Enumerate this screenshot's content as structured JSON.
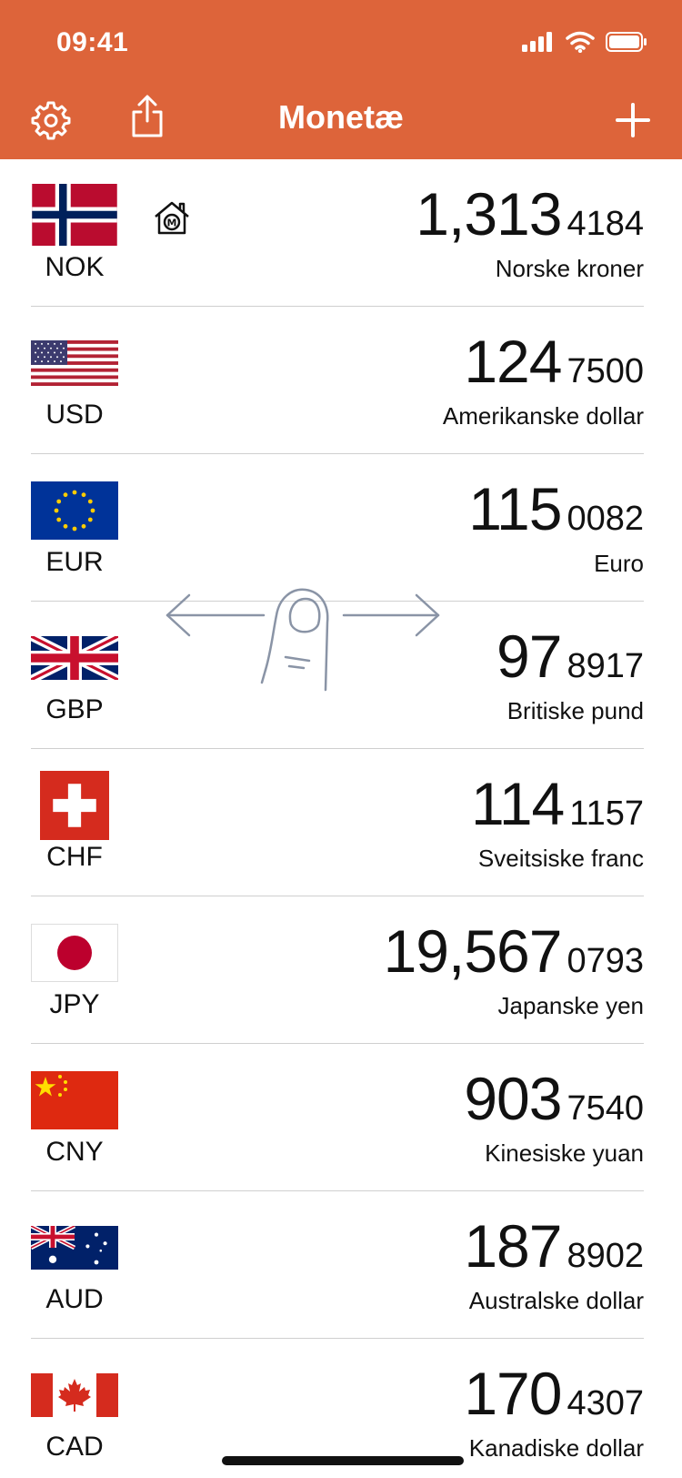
{
  "status_bar": {
    "time": "09:41"
  },
  "nav": {
    "title": "Monetæ",
    "settings_icon": "gear-icon",
    "share_icon": "share-icon",
    "add_icon": "plus-icon",
    "color": "#DD643A"
  },
  "currencies": [
    {
      "code": "NOK",
      "amount_int": "1,313",
      "amount_dec": "4184",
      "name": "Norske kroner",
      "home": true
    },
    {
      "code": "USD",
      "amount_int": "124",
      "amount_dec": "7500",
      "name": "Amerikanske dollar"
    },
    {
      "code": "EUR",
      "amount_int": "115",
      "amount_dec": "0082",
      "name": "Euro"
    },
    {
      "code": "GBP",
      "amount_int": "97",
      "amount_dec": "8917",
      "name": "Britiske pund"
    },
    {
      "code": "CHF",
      "amount_int": "114",
      "amount_dec": "1157",
      "name": "Sveitsiske franc"
    },
    {
      "code": "JPY",
      "amount_int": "19,567",
      "amount_dec": "0793",
      "name": "Japanske yen"
    },
    {
      "code": "CNY",
      "amount_int": "903",
      "amount_dec": "7540",
      "name": "Kinesiske yuan"
    },
    {
      "code": "AUD",
      "amount_int": "187",
      "amount_dec": "8902",
      "name": "Australske dollar"
    },
    {
      "code": "CAD",
      "amount_int": "170",
      "amount_dec": "4307",
      "name": "Kanadiske dollar"
    }
  ]
}
